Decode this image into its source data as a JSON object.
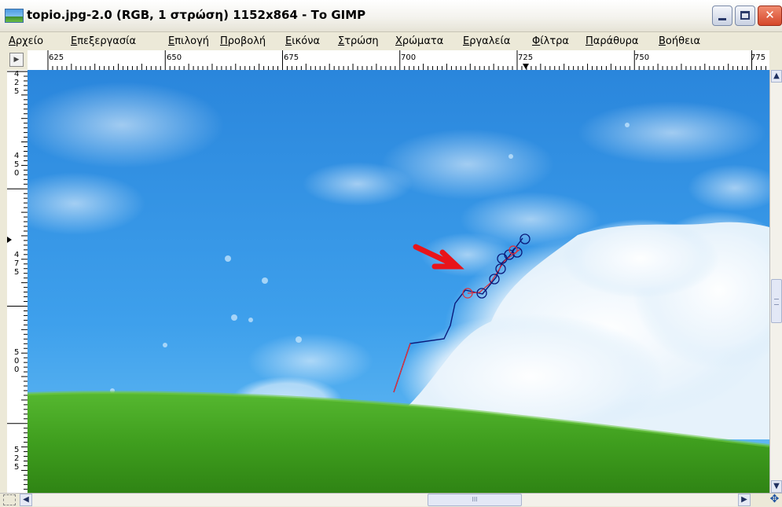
{
  "window": {
    "title": "topio.jpg-2.0 (RGB, 1 στρώση) 1152x864 - Το GIMP",
    "min_glyph": "_",
    "close_glyph": "✕"
  },
  "menu": [
    "Αρχείο",
    "Επεξεργασία",
    "Επιλογή",
    "Προβολή",
    "Εικόνα",
    "Στρώση",
    "Χρώματα",
    "Εργαλεία",
    "Φίλτρα",
    "Παράθυρα",
    "Βοήθεια"
  ],
  "hruler_labels": [
    "625",
    "650",
    "675",
    "700",
    "725",
    "750",
    "775"
  ],
  "vruler_labels": [
    "425",
    "450",
    "475",
    "500",
    "525"
  ],
  "scroll": {
    "up": "▲",
    "down": "▼",
    "left": "◀",
    "right": "▶",
    "grip": "III"
  },
  "nav_icon": "✥",
  "corner_icon": "▶",
  "colors": {
    "sky_top": "#2b8be0",
    "sky_bottom": "#58b4f2",
    "cloud": "#eef6fc",
    "grass": "#3e9e1f",
    "arrow": "#e8141a",
    "path_blue": "#0a1a7a",
    "path_red": "#e0303a"
  }
}
